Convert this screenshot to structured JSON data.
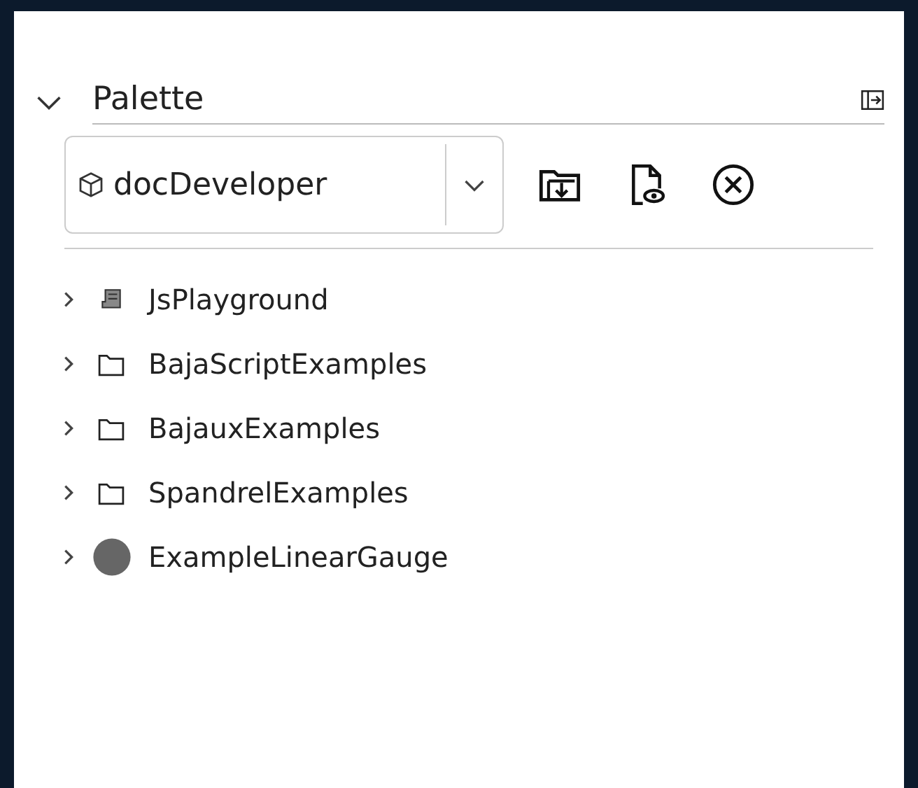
{
  "palette": {
    "title": "Palette",
    "expanded": true
  },
  "selector": {
    "value": "docDeveloper"
  },
  "tree": [
    {
      "label": "JsPlayground",
      "kind": "script",
      "expanded": false
    },
    {
      "label": "BajaScriptExamples",
      "kind": "folder",
      "expanded": false
    },
    {
      "label": "BajauxExamples",
      "kind": "folder",
      "expanded": false
    },
    {
      "label": "SpandrelExamples",
      "kind": "folder",
      "expanded": false
    },
    {
      "label": "ExampleLinearGauge",
      "kind": "gauge",
      "expanded": false
    }
  ]
}
